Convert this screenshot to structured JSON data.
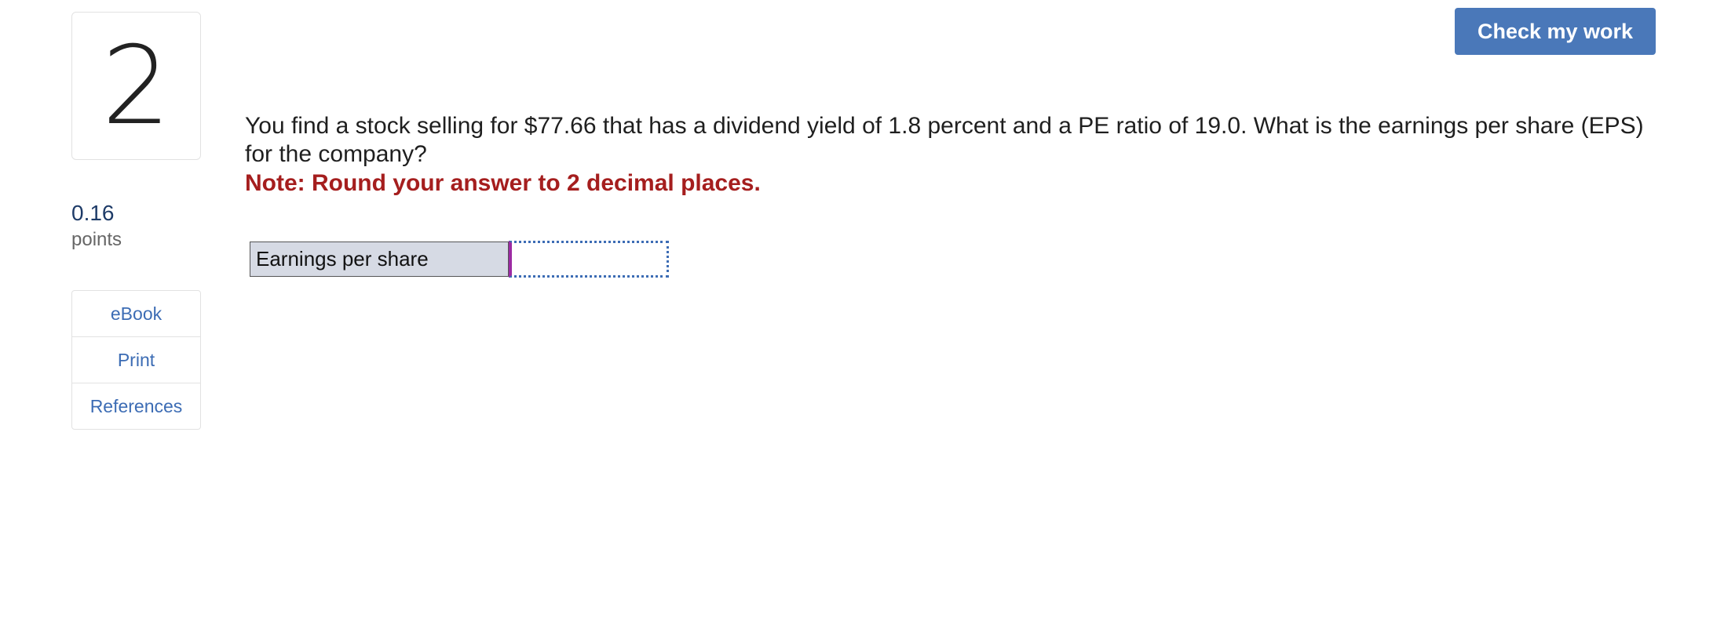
{
  "question": {
    "number": "2",
    "points_value": "0.16",
    "points_label": "points",
    "text": "You find a stock selling for $77.66 that has a dividend yield of 1.8 percent and a PE ratio of 19.0. What is the earnings per share (EPS) for the company?",
    "note": "Note: Round your answer to 2 decimal places."
  },
  "resources": {
    "items": [
      {
        "label": "eBook"
      },
      {
        "label": "Print"
      },
      {
        "label": "References"
      }
    ]
  },
  "toolbar": {
    "check_label": "Check my work"
  },
  "answer": {
    "label": "Earnings per share",
    "value": "",
    "placeholder": ""
  },
  "colors": {
    "accent": "#4a78b9",
    "link": "#3c6cb4",
    "note": "#a51e1e",
    "points": "#1e3b68",
    "label_bg": "#d6dae4"
  }
}
